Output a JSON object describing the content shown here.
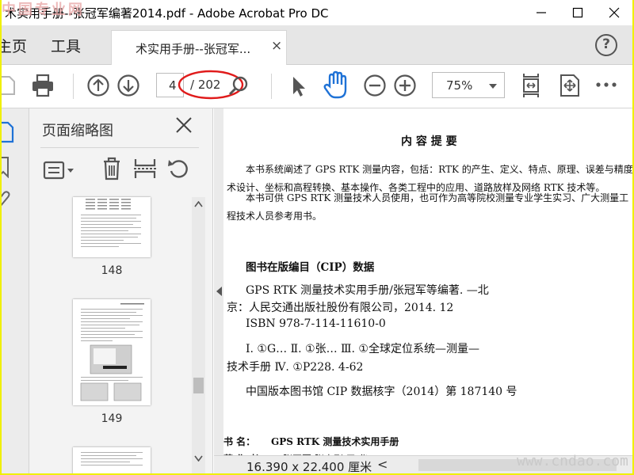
{
  "window": {
    "title": "术实用手册--张冠军编著2014.pdf - Adobe Acrobat Pro DC",
    "minimize": "—",
    "maximize": "☐",
    "close": "✕"
  },
  "nav": {
    "home": "主页",
    "tools": "工具",
    "doc_tab": "术实用手册--张冠军...",
    "doc_tab_close": "×",
    "help": "?"
  },
  "toolbar": {
    "page_current": "4",
    "page_total": "/ 202",
    "zoom": "75%",
    "icons": [
      "save-icon",
      "print-icon",
      "prev-page-icon",
      "next-page-icon",
      "find-icon",
      "select-pointer-icon",
      "hand-icon",
      "zoom-out-icon",
      "zoom-in-icon",
      "fit-page-icon",
      "full-screen-icon",
      "more-icon"
    ]
  },
  "panel": {
    "title": "页面缩略图",
    "close": "×",
    "thumbs": [
      {
        "label": "148"
      },
      {
        "label": "149"
      }
    ]
  },
  "page": {
    "heading": "内 容 提 要",
    "para1_line1": "本书系统阐述了 GPS RTK 测量内容，包括：RTK 的产生、定义、特点、原理、误差与精度、技",
    "para1_line2": "术设计、坐标和高程转换、基本操作、各类工程中的应用、道路放样及网络 RTK 技术等。",
    "para2_line1": "本书可供 GPS RTK 测量技术人员使用，也可作为高等院校测量专业学生实习、广大测量工",
    "para2_line2": "程技术人员参考用书。",
    "cip_title": "图书在版编目（CIP）数据",
    "cip_line1": "GPS RTK 测量技术实用手册/张冠军等编著. —北",
    "cip_line2": "京：人民交通出版社股份有限公司，2014. 12",
    "cip_line3": "ISBN 978-7-114-11610-0",
    "cip_line4": "Ⅰ. ①G…  Ⅱ. ①张…   Ⅲ. ①全球定位系统—测量—",
    "cip_line5": "技术手册  Ⅳ. ①P228. 4-62",
    "cip_line6": "中国版本图书馆 CIP 数据核字（2014）第 187140 号",
    "book_label": "书    名：",
    "book_name": "GPS RTK 测量技术实用手册",
    "author_label": "著 作 者：",
    "author_name": "张冠军   张志刚   于   华"
  },
  "status": {
    "dimensions": "16.390 x 22.400 厘米",
    "scroll_left": "<"
  },
  "watermarks": {
    "top_left": "中国专业网",
    "bottom_right": "www.cndao.com"
  },
  "colors": {
    "annotation_circle": "#e01b1b",
    "hand_tool": "#1f72d6",
    "panel_icon": "#1f72d6",
    "outer_border": "#f0f000"
  }
}
